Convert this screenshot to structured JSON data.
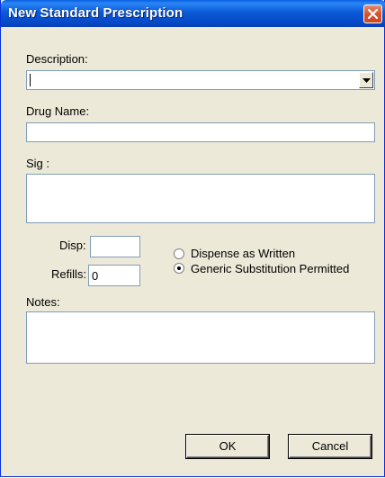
{
  "window": {
    "title": "New Standard Prescription"
  },
  "form": {
    "description_label": "Description:",
    "description_value": "",
    "drug_name_label": "Drug Name:",
    "drug_name_value": "",
    "sig_label": "Sig :",
    "sig_value": "",
    "disp_label": "Disp:",
    "disp_value": "",
    "refills_label": "Refills:",
    "refills_value": "0",
    "radio_dispense_written": "Dispense as Written",
    "radio_generic": "Generic Substitution Permitted",
    "selected_radio": "generic",
    "notes_label": "Notes:",
    "notes_value": ""
  },
  "buttons": {
    "ok": "OK",
    "cancel": "Cancel"
  },
  "icons": {
    "close": "close-icon",
    "dropdown": "chevron-down-icon"
  },
  "colors": {
    "titlebar": "#0b5ad6",
    "close": "#d9532c",
    "dialog_bg": "#ece9d8"
  }
}
